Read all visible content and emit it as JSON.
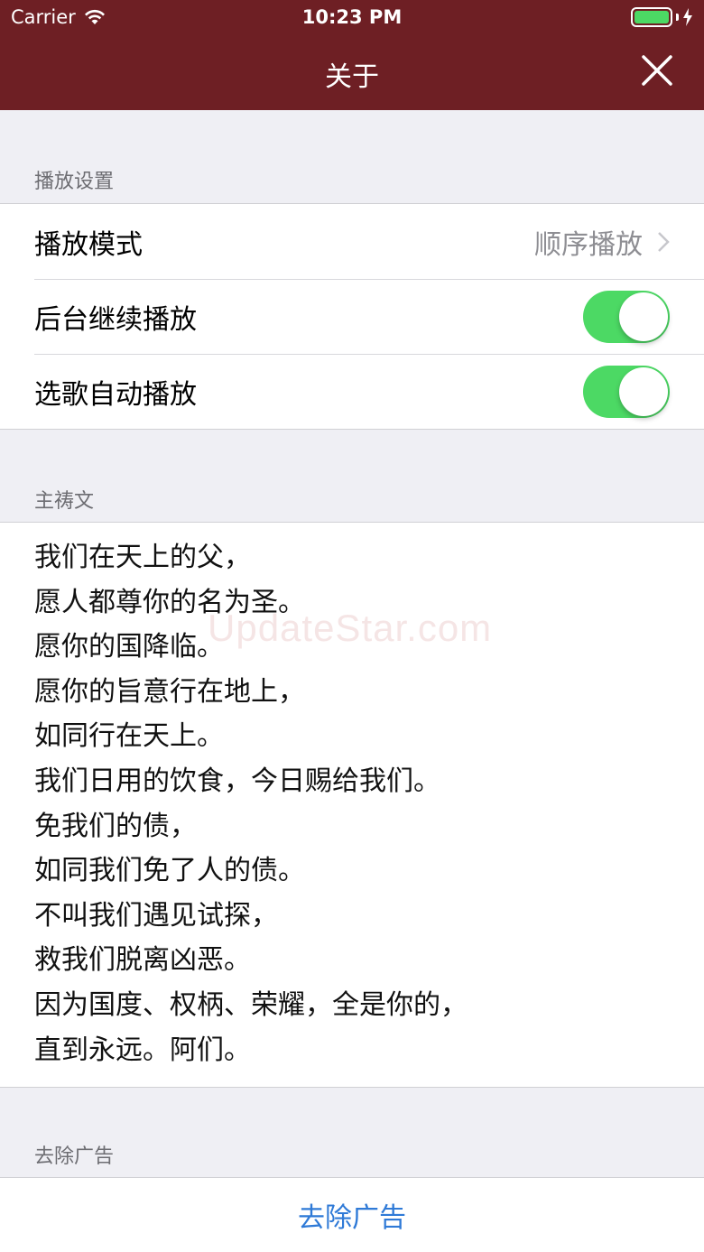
{
  "status_bar": {
    "carrier": "Carrier",
    "time": "10:23 PM"
  },
  "nav": {
    "title": "关于",
    "close_icon": "close-icon"
  },
  "playback_section": {
    "header": "播放设置",
    "rows": [
      {
        "label": "播放模式",
        "value": "顺序播放"
      },
      {
        "label": "后台继续播放",
        "toggle_on": true
      },
      {
        "label": "选歌自动播放",
        "toggle_on": true
      }
    ]
  },
  "prayer_section": {
    "header": "主祷文",
    "lines": [
      "我们在天上的父，",
      "愿人都尊你的名为圣。",
      "愿你的国降临。",
      "愿你的旨意行在地上，",
      "如同行在天上。",
      "我们日用的饮食，今日赐给我们。",
      "免我们的债，",
      "如同我们免了人的债。",
      "不叫我们遇见试探，",
      "救我们脱离凶恶。",
      "因为国度、权柄、荣耀，全是你的，",
      "直到永远。阿们。"
    ]
  },
  "ads_section": {
    "header": "去除广告",
    "button_label": "去除广告"
  },
  "watermark": "UpdateStar.com",
  "colors": {
    "nav_background": "#6e1f24",
    "toggle_on": "#4cd964",
    "link_blue": "#2f7ad7",
    "battery": "#4cd964"
  }
}
